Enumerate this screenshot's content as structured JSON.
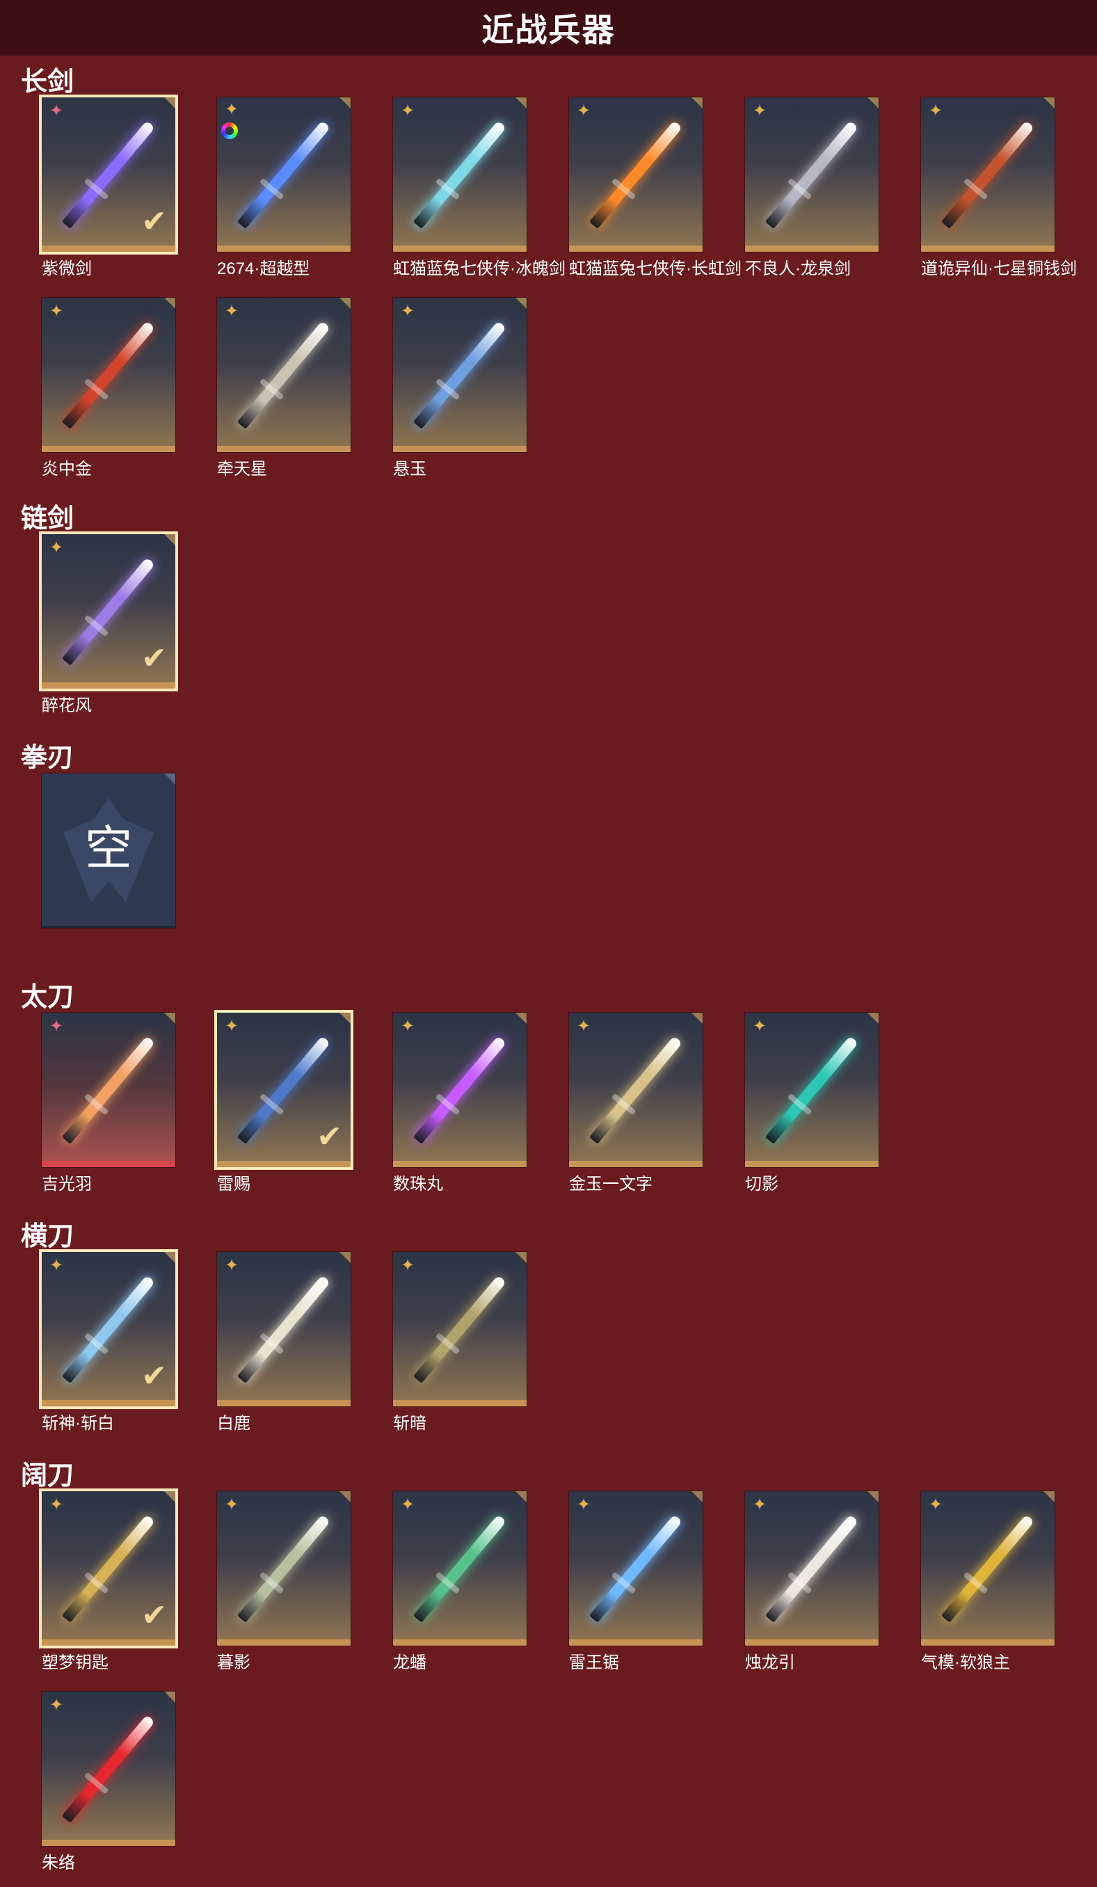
{
  "page_title": "近战兵器",
  "empty_slot_text": "空",
  "sections": [
    {
      "title": "长剑",
      "items": [
        {
          "name": "紫微剑",
          "rarity": "pink",
          "selected": true,
          "color": "#8a6cff"
        },
        {
          "name": "2674·超越型",
          "rarity": "rainbow",
          "selected": false,
          "color": "#5a8cff"
        },
        {
          "name": "虹猫蓝兔七侠传·冰魄剑",
          "rarity": "gold",
          "selected": false,
          "color": "#7fd8e6"
        },
        {
          "name": "虹猫蓝兔七侠传·长虹剑",
          "rarity": "gold",
          "selected": false,
          "color": "#ff8a2a"
        },
        {
          "name": "不良人·龙泉剑",
          "rarity": "gold",
          "selected": false,
          "color": "#b7b7c4"
        },
        {
          "name": "道诡异仙·七星铜钱剑",
          "rarity": "gold",
          "selected": false,
          "color": "#c2532c"
        },
        {
          "name": "炎中金",
          "rarity": "gold",
          "selected": false,
          "color": "#d1442b"
        },
        {
          "name": "牵天星",
          "rarity": "gold",
          "selected": false,
          "color": "#c9c3b3"
        },
        {
          "name": "悬玉",
          "rarity": "gold",
          "selected": false,
          "color": "#6f9fe0"
        }
      ]
    },
    {
      "title": "链剑",
      "items": [
        {
          "name": "醉花风",
          "rarity": "gold",
          "selected": true,
          "color": "#9e7ce8"
        }
      ]
    },
    {
      "title": "拳刃",
      "items": [
        {
          "name": "",
          "rarity": "none",
          "selected": false,
          "empty": true,
          "color": "#2f3a52"
        }
      ]
    },
    {
      "title": "太刀",
      "items": [
        {
          "name": "吉光羽",
          "rarity": "pink",
          "selected": false,
          "red": true,
          "color": "#f2a063"
        },
        {
          "name": "雷赐",
          "rarity": "gold",
          "selected": true,
          "color": "#4e79c9"
        },
        {
          "name": "数珠丸",
          "rarity": "gold",
          "selected": false,
          "color": "#c65cff"
        },
        {
          "name": "金玉一文字",
          "rarity": "gold",
          "selected": false,
          "color": "#d8c28a"
        },
        {
          "name": "切影",
          "rarity": "gold",
          "selected": false,
          "color": "#2ec7b3"
        }
      ]
    },
    {
      "title": "横刀",
      "items": [
        {
          "name": "斩神·斩白",
          "rarity": "gold",
          "selected": true,
          "color": "#8fc7ee"
        },
        {
          "name": "白鹿",
          "rarity": "gold",
          "selected": false,
          "color": "#e8e2d0"
        },
        {
          "name": "斩暗",
          "rarity": "gold",
          "selected": false,
          "color": "#b1a36c"
        }
      ]
    },
    {
      "title": "阔刀",
      "items": [
        {
          "name": "塑梦钥匙",
          "rarity": "gold",
          "selected": true,
          "color": "#d7b156"
        },
        {
          "name": "暮影",
          "rarity": "gold",
          "selected": false,
          "color": "#b7c0a0"
        },
        {
          "name": "龙蟠",
          "rarity": "gold",
          "selected": false,
          "color": "#58c28c"
        },
        {
          "name": "雷王锯",
          "rarity": "gold",
          "selected": false,
          "color": "#6fb9ff"
        },
        {
          "name": "烛龙引",
          "rarity": "gold",
          "selected": false,
          "color": "#ece8e0"
        },
        {
          "name": "气模·软狼主",
          "rarity": "gold",
          "selected": false,
          "color": "#e0b33a"
        },
        {
          "name": "朱络",
          "rarity": "gold",
          "selected": false,
          "color": "#e5272f"
        }
      ]
    }
  ]
}
